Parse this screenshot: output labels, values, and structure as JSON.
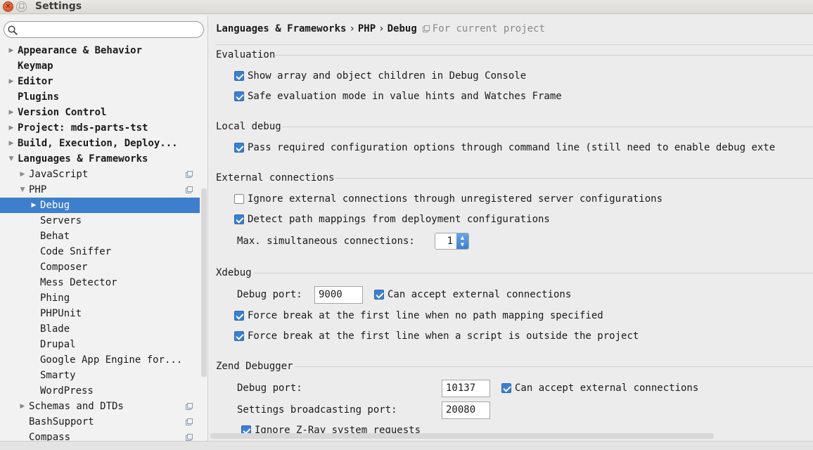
{
  "window": {
    "title": "Settings",
    "close_glyph": "✕",
    "max_glyph": "□"
  },
  "search": {
    "placeholder": "",
    "value": ""
  },
  "tree": [
    {
      "label": "Appearance & Behavior",
      "level": 0,
      "arrow": "right",
      "bold": true
    },
    {
      "label": "Keymap",
      "level": 0,
      "arrow": "none",
      "bold": true
    },
    {
      "label": "Editor",
      "level": 0,
      "arrow": "right",
      "bold": true
    },
    {
      "label": "Plugins",
      "level": 0,
      "arrow": "none",
      "bold": true
    },
    {
      "label": "Version Control",
      "level": 0,
      "arrow": "right",
      "bold": true
    },
    {
      "label": "Project: mds-parts-tst",
      "level": 0,
      "arrow": "right",
      "bold": true
    },
    {
      "label": "Build, Execution, Deploy...",
      "level": 0,
      "arrow": "right",
      "bold": true
    },
    {
      "label": "Languages & Frameworks",
      "level": 0,
      "arrow": "down",
      "bold": true
    },
    {
      "label": "JavaScript",
      "level": 1,
      "arrow": "right",
      "bold": false,
      "project_icon": true
    },
    {
      "label": "PHP",
      "level": 1,
      "arrow": "down",
      "bold": false,
      "project_icon": true
    },
    {
      "label": "Debug",
      "level": 2,
      "arrow": "right",
      "bold": false,
      "selected": true
    },
    {
      "label": "Servers",
      "level": 2,
      "arrow": "none",
      "bold": false
    },
    {
      "label": "Behat",
      "level": 2,
      "arrow": "none",
      "bold": false
    },
    {
      "label": "Code Sniffer",
      "level": 2,
      "arrow": "none",
      "bold": false
    },
    {
      "label": "Composer",
      "level": 2,
      "arrow": "none",
      "bold": false
    },
    {
      "label": "Mess Detector",
      "level": 2,
      "arrow": "none",
      "bold": false
    },
    {
      "label": "Phing",
      "level": 2,
      "arrow": "none",
      "bold": false
    },
    {
      "label": "PHPUnit",
      "level": 2,
      "arrow": "none",
      "bold": false
    },
    {
      "label": "Blade",
      "level": 2,
      "arrow": "none",
      "bold": false
    },
    {
      "label": "Drupal",
      "level": 2,
      "arrow": "none",
      "bold": false
    },
    {
      "label": "Google App Engine for...",
      "level": 2,
      "arrow": "none",
      "bold": false
    },
    {
      "label": "Smarty",
      "level": 2,
      "arrow": "none",
      "bold": false
    },
    {
      "label": "WordPress",
      "level": 2,
      "arrow": "none",
      "bold": false
    },
    {
      "label": "Schemas and DTDs",
      "level": 1,
      "arrow": "right",
      "bold": false,
      "project_icon": true
    },
    {
      "label": "BashSupport",
      "level": 1,
      "arrow": "none",
      "bold": false,
      "project_icon": true
    },
    {
      "label": "Compass",
      "level": 1,
      "arrow": "none",
      "bold": false,
      "project_icon": true
    }
  ],
  "breadcrumb": {
    "part1": "Languages & Frameworks",
    "sep": "›",
    "part2": "PHP",
    "part3": "Debug",
    "scope": "For current project"
  },
  "evaluation": {
    "title": "Evaluation",
    "show_array": {
      "label": "Show array and object children in Debug Console",
      "checked": true
    },
    "safe_eval": {
      "label": "Safe evaluation mode in value hints and Watches Frame",
      "checked": true
    }
  },
  "local_debug": {
    "title": "Local debug",
    "pass_config": {
      "label": "Pass required configuration options through command line (still need to enable debug exte",
      "checked": true
    }
  },
  "external": {
    "title": "External connections",
    "ignore_unregistered": {
      "label": "Ignore external connections through unregistered server configurations",
      "checked": false
    },
    "detect_mappings": {
      "label": "Detect path mappings from deployment configurations",
      "checked": true
    },
    "max_label": "Max. simultaneous connections:",
    "max_value": "1"
  },
  "xdebug": {
    "title": "Xdebug",
    "port_label": "Debug port:",
    "port_value": "9000",
    "accept_external": {
      "label": "Can accept external connections",
      "checked": true
    },
    "force_break_no_mapping": {
      "label": "Force break at the first line when no path mapping specified",
      "checked": true
    },
    "force_break_outside": {
      "label": "Force break at the first line when a script is outside the project",
      "checked": true
    }
  },
  "zend": {
    "title": "Zend Debugger",
    "port_label": "Debug port:",
    "port_value": "10137",
    "accept_external": {
      "label": "Can accept external connections",
      "checked": true
    },
    "broadcast_label": "Settings broadcasting port:",
    "broadcast_value": "20080",
    "ignore_zray": {
      "label": "Ignore Z-Ray system requests",
      "checked": true
    }
  },
  "colors": {
    "accent": "#3d7fcd",
    "checkbox": "#3b7fd1",
    "window_bg": "#ececec"
  }
}
